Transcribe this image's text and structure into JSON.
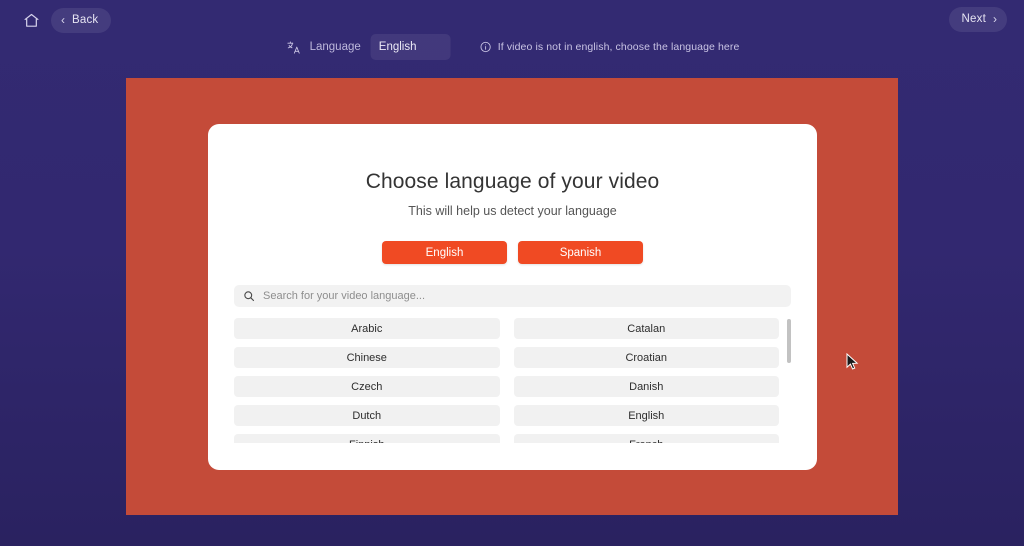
{
  "topbar": {
    "home_icon": "home-icon",
    "back_chevron": "‹",
    "back_label": "Back",
    "next_label": "Next",
    "next_chevron": "›"
  },
  "language_strip": {
    "translate_icon": "translate-icon",
    "label": "Language",
    "input_value": "English",
    "input_placeholder": "Language",
    "info_icon": "info-circle-icon",
    "hint": "If video is not in english, choose the language here"
  },
  "modal": {
    "title": "Choose language of your video",
    "subtitle": "This will help us detect your language",
    "quick_options": [
      {
        "label": "English"
      },
      {
        "label": "Spanish"
      }
    ],
    "search": {
      "icon": "search-icon",
      "value": "",
      "placeholder": "Search for your video language..."
    },
    "languages": [
      "Arabic",
      "Catalan",
      "Chinese",
      "Croatian",
      "Czech",
      "Danish",
      "Dutch",
      "English",
      "Finnish",
      "French"
    ]
  },
  "colors": {
    "app_background": "#322870",
    "content_panel": "#c44b39",
    "modal_background": "#ffffff",
    "accent_button": "#f04a23",
    "list_item_background": "#f1f1f1",
    "search_background": "#f2f2f2",
    "scrollbar_thumb": "#c2c2c2"
  }
}
